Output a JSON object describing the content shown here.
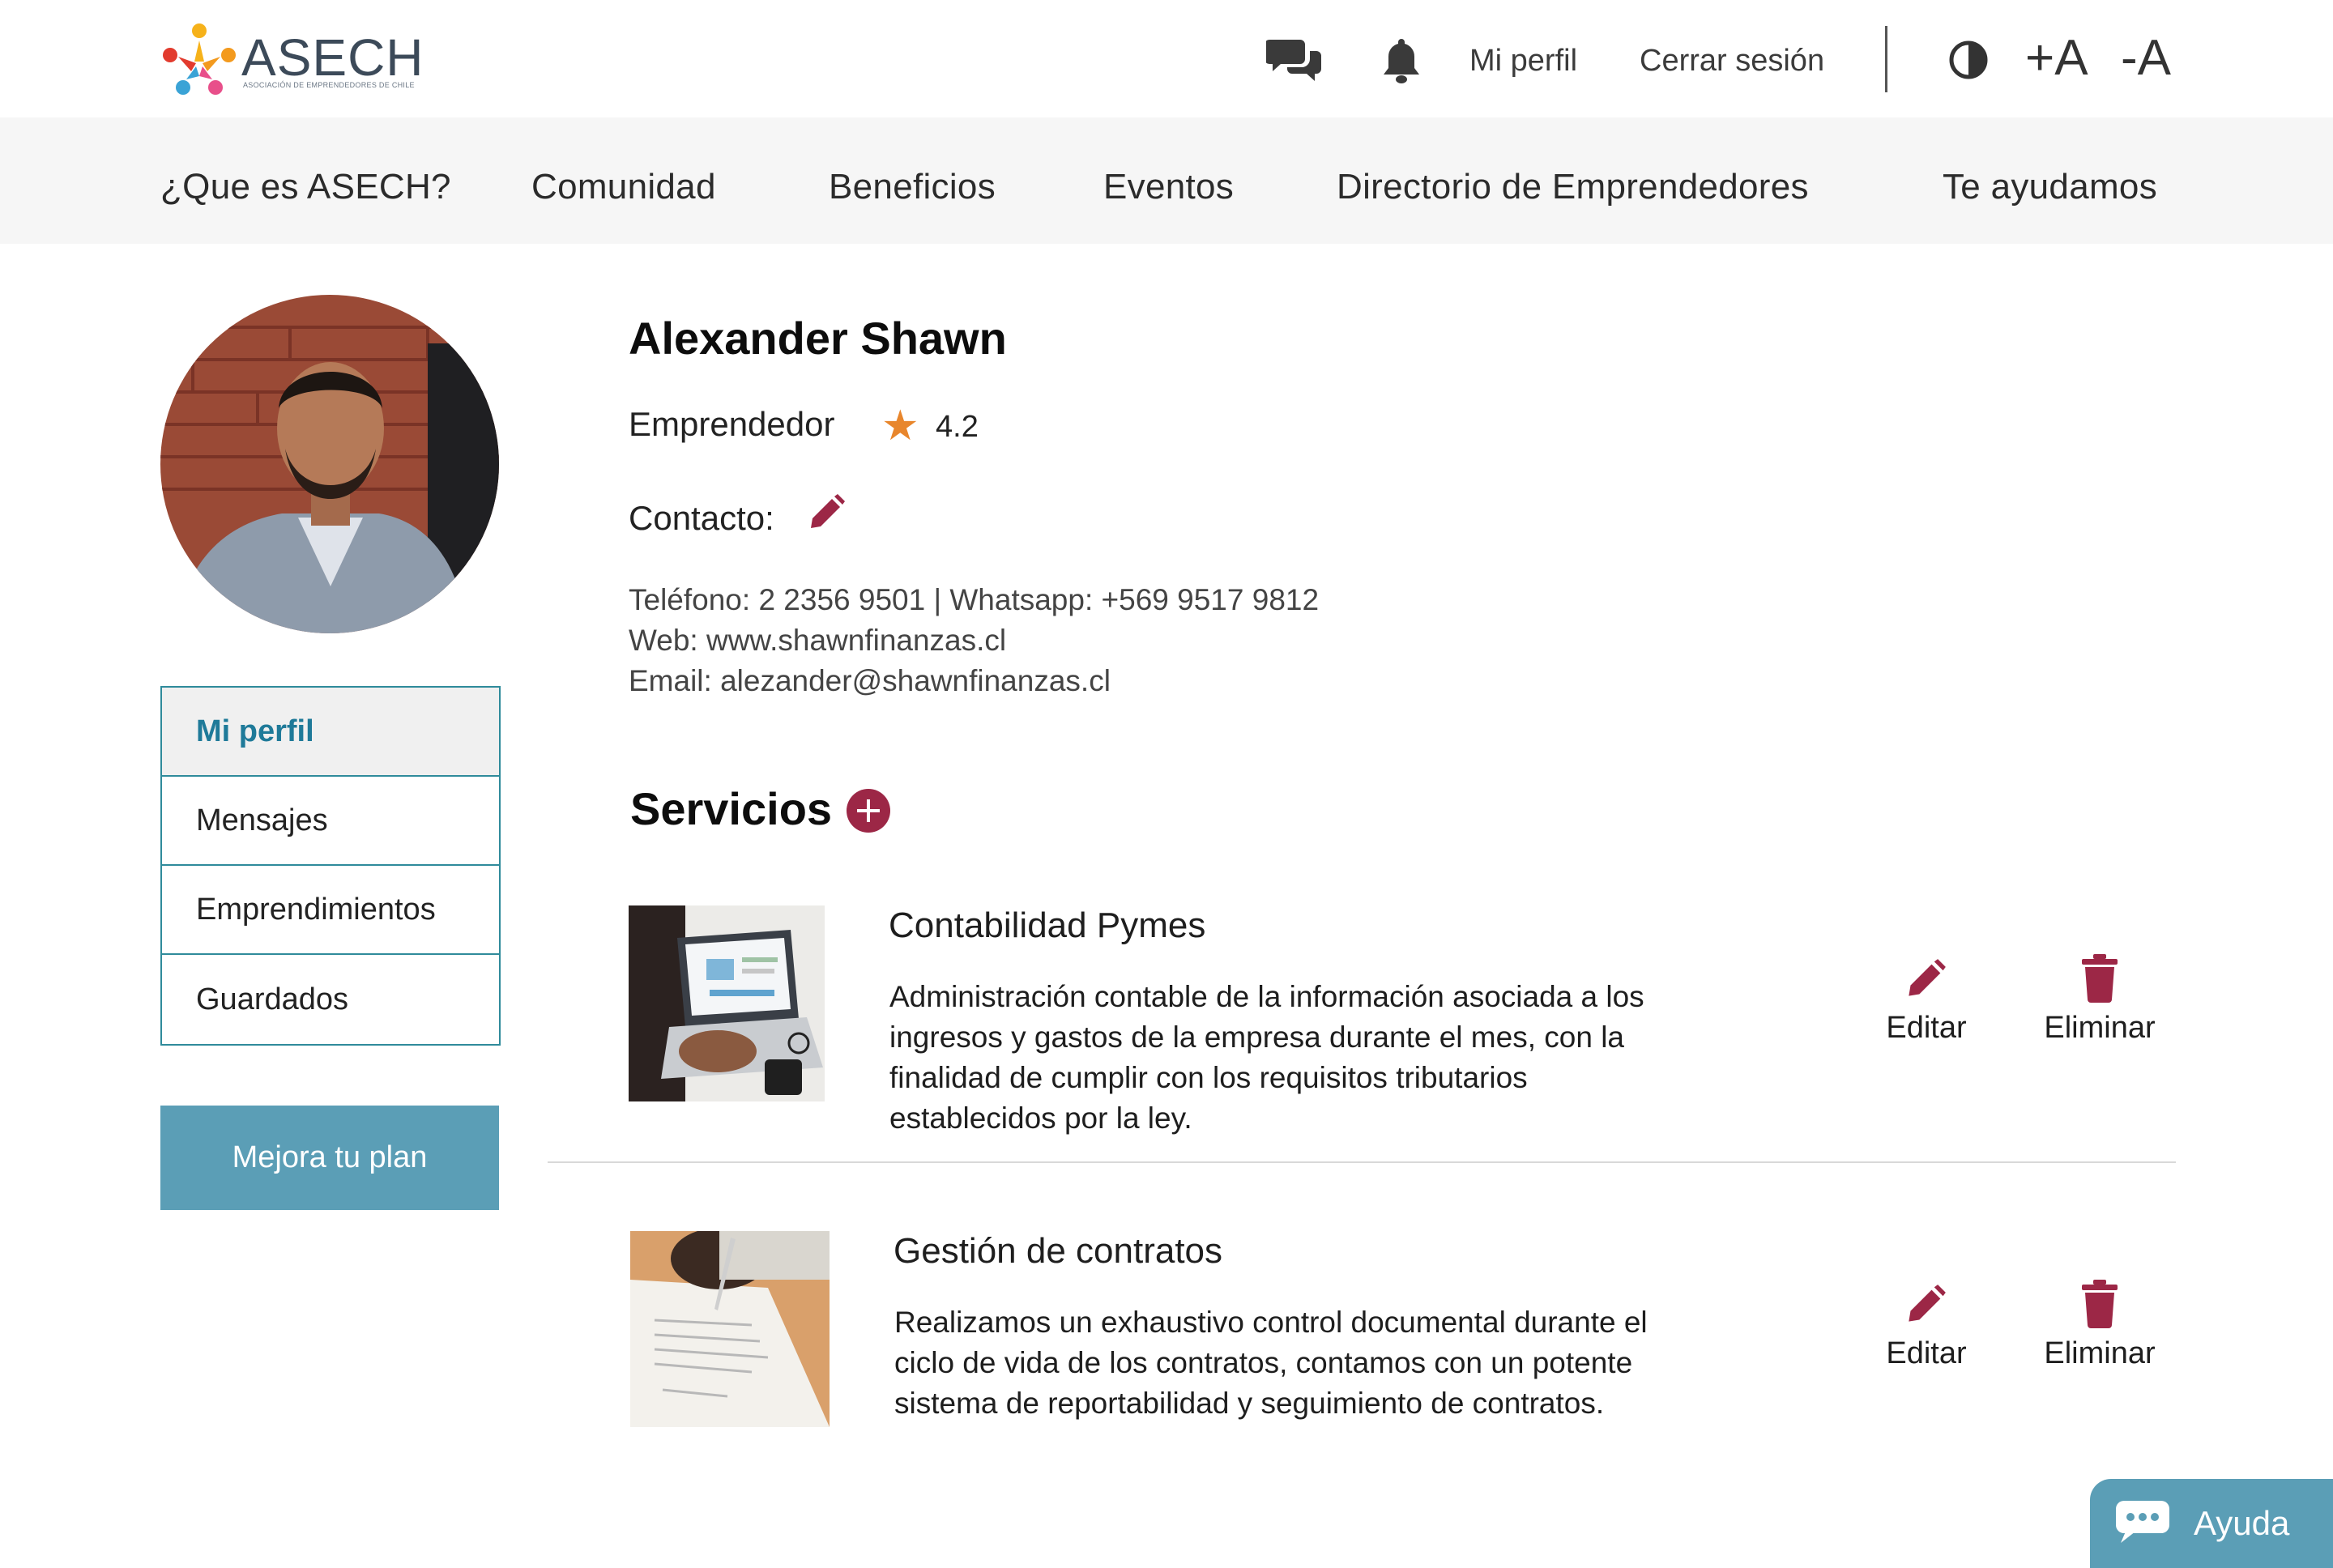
{
  "brand": {
    "logo_word": "ASECH",
    "logo_subtitle": "ASOCIACIÓN DE EMPRENDEDORES DE CHILE",
    "accent": "#9c2746",
    "teal": "#2f8b9b",
    "button_blue": "#5b9eb6",
    "star_color": "#e8862c"
  },
  "header": {
    "chat_icon": "chat-bubbles-icon",
    "bell_icon": "bell-icon",
    "my_profile": "Mi perfil",
    "logout": "Cerrar sesión",
    "contrast_icon": "contrast-icon",
    "font_increase": "+A",
    "font_decrease": "-A"
  },
  "nav": {
    "items": [
      "¿Que es ASECH?",
      "Comunidad",
      "Beneficios",
      "Eventos",
      "Directorio de Emprendedores",
      "Te ayudamos"
    ]
  },
  "sidebar": {
    "items": [
      "Mi perfil",
      "Mensajes",
      "Emprendimientos",
      "Guardados"
    ],
    "active_index": 0,
    "plan_button": "Mejora tu plan"
  },
  "profile": {
    "name": "Alexander Shawn",
    "role": "Emprendedor",
    "rating": "4.2",
    "contact_label": "Contacto:",
    "phone_line": "Teléfono: 2 2356 9501   |   Whatsapp: +569 9517 9812",
    "web_line": "Web: www.shawnfinanzas.cl",
    "email_line": "Email: alezander@shawnfinanzas.cl"
  },
  "services": {
    "title": "Servicios",
    "edit_label": "Editar",
    "delete_label": "Eliminar",
    "items": [
      {
        "title": "Contabilidad Pymes",
        "description": "Administración contable de la información asociada a los ingresos y gastos de la empresa durante el mes, con la finalidad de cumplir con los requisitos tributarios establecidos por la ley."
      },
      {
        "title": "Gestión de contratos",
        "description": "Realizamos un exhaustivo control documental durante el ciclo de vida de los contratos, contamos con un potente sistema de reportabilidad y seguimiento de contratos."
      }
    ]
  },
  "help": {
    "label": "Ayuda"
  }
}
